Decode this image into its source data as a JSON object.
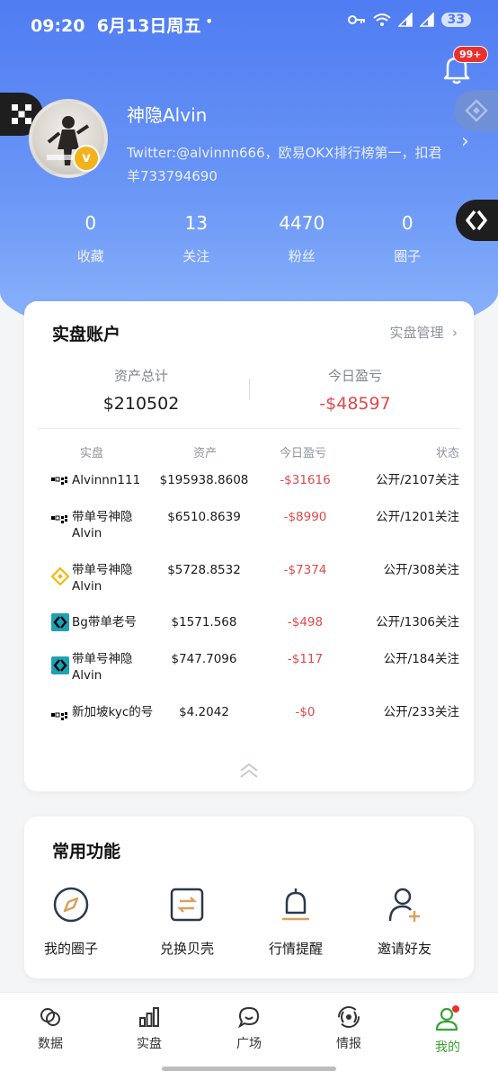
{
  "status_bar": {
    "time": "09:20",
    "date": "6月13日周五",
    "dot": "•",
    "battery": "33"
  },
  "notifications": {
    "badge": "99+"
  },
  "profile": {
    "name": "神隐Alvin",
    "bio": "Twitter:@alvinnn666，欧易OKX排行榜第一，扣君羊733794690",
    "verified_badge": "v"
  },
  "stats": [
    {
      "value": "0",
      "label": "收藏"
    },
    {
      "value": "13",
      "label": "关注"
    },
    {
      "value": "4470",
      "label": "粉丝"
    },
    {
      "value": "0",
      "label": "圈子"
    }
  ],
  "account": {
    "title": "实盘账户",
    "manage_label": "实盘管理",
    "total_label": "资产总计",
    "total_value": "$210502",
    "today_label": "今日盈亏",
    "today_value": "-$48597",
    "columns": [
      "实盘",
      "资产",
      "今日盈亏",
      "状态"
    ],
    "rows": [
      {
        "exchange_icon": "okx-icon",
        "name": "Alvinnn111",
        "asset": "$195938.8608",
        "pnl": "-$31616",
        "status": "公开/2107关注"
      },
      {
        "exchange_icon": "okx-icon",
        "name": "带单号神隐Alvin",
        "asset": "$6510.8639",
        "pnl": "-$8990",
        "status": "公开/1201关注"
      },
      {
        "exchange_icon": "binance-icon",
        "name": "带单号神隐Alvin",
        "asset": "$5728.8532",
        "pnl": "-$7374",
        "status": "公开/308关注"
      },
      {
        "exchange_icon": "bitget-icon",
        "name": "Bg带单老号",
        "asset": "$1571.568",
        "pnl": "-$498",
        "status": "公开/1306关注"
      },
      {
        "exchange_icon": "bitget-icon",
        "name": "带单号神隐Alvin",
        "asset": "$747.7096",
        "pnl": "-$117",
        "status": "公开/184关注"
      },
      {
        "exchange_icon": "okx-icon",
        "name": "新加坡kyc的号",
        "asset": "$4.2042",
        "pnl": "-$0",
        "status": "公开/233关注"
      }
    ]
  },
  "functions": {
    "title": "常用功能",
    "items": [
      {
        "icon": "compass-icon",
        "label": "我的圈子"
      },
      {
        "icon": "exchange-icon",
        "label": "兑换贝壳"
      },
      {
        "icon": "bell-icon",
        "label": "行情提醒"
      },
      {
        "icon": "add-user-icon",
        "label": "邀请好友"
      }
    ]
  },
  "tabbar": {
    "active": "我的",
    "tabs": [
      {
        "icon": "circles-icon",
        "label": "数据"
      },
      {
        "icon": "bar-chart-icon",
        "label": "实盘"
      },
      {
        "icon": "chat-icon",
        "label": "广场"
      },
      {
        "icon": "broadcast-icon",
        "label": "情报"
      },
      {
        "icon": "user-icon",
        "label": "我的"
      }
    ]
  },
  "colors": {
    "accent": "#4f7cf2",
    "negative": "#e0494a",
    "active_tab": "#3aa334"
  }
}
